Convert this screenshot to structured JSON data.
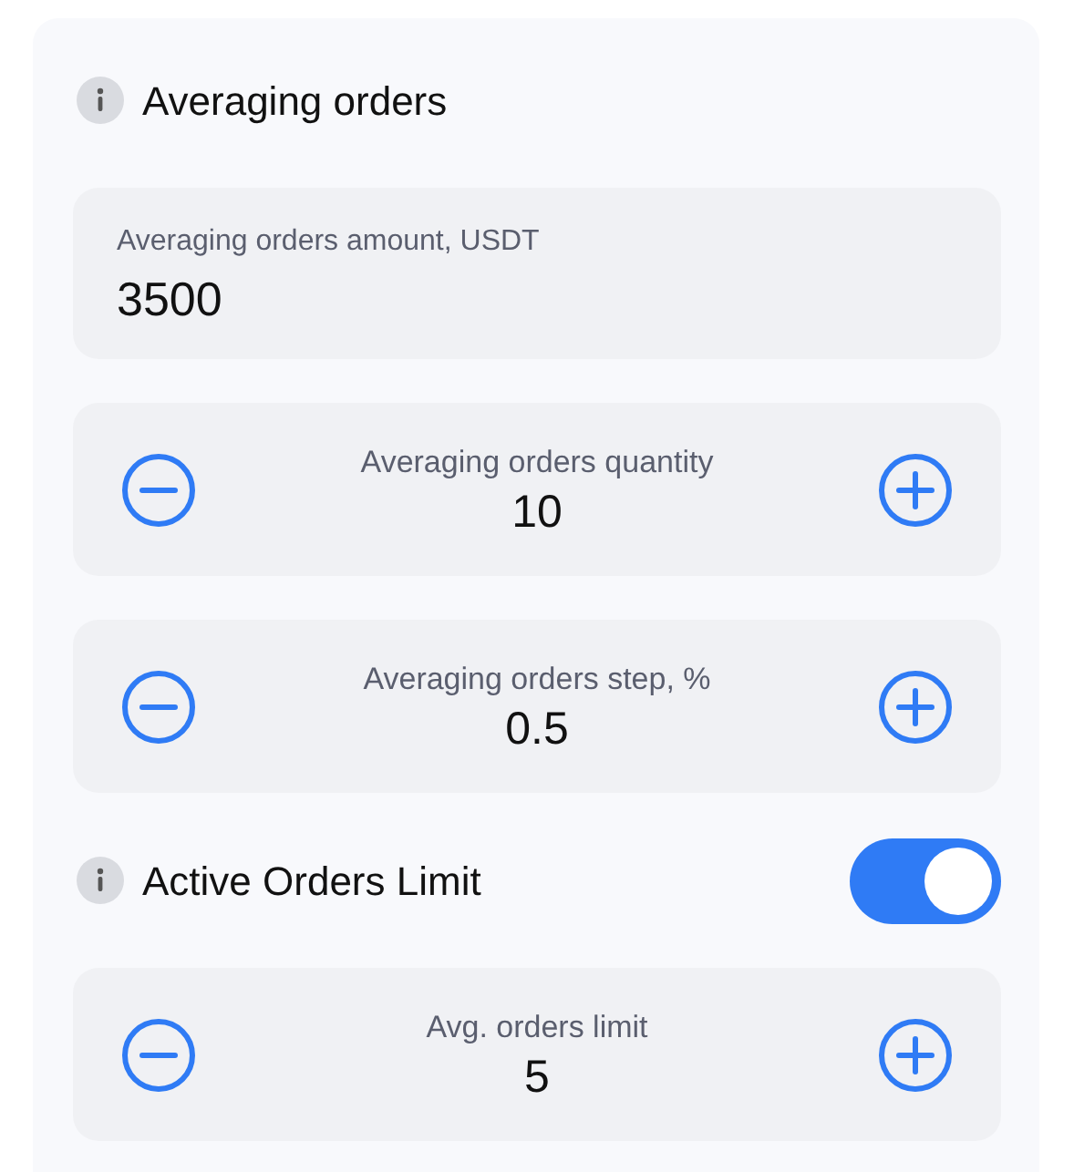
{
  "sections": [
    {
      "kind": "header",
      "title": "Averaging orders"
    },
    {
      "kind": "field",
      "label": "Averaging orders amount, USDT",
      "value": "3500"
    },
    {
      "kind": "stepper",
      "label": "Averaging orders quantity",
      "value": "10"
    },
    {
      "kind": "stepper",
      "label": "Averaging orders step, %",
      "value": "0.5"
    },
    {
      "kind": "header",
      "title": "Active Orders Limit",
      "on": true
    },
    {
      "kind": "stepper",
      "label": "Avg. orders limit",
      "value": "5"
    }
  ]
}
